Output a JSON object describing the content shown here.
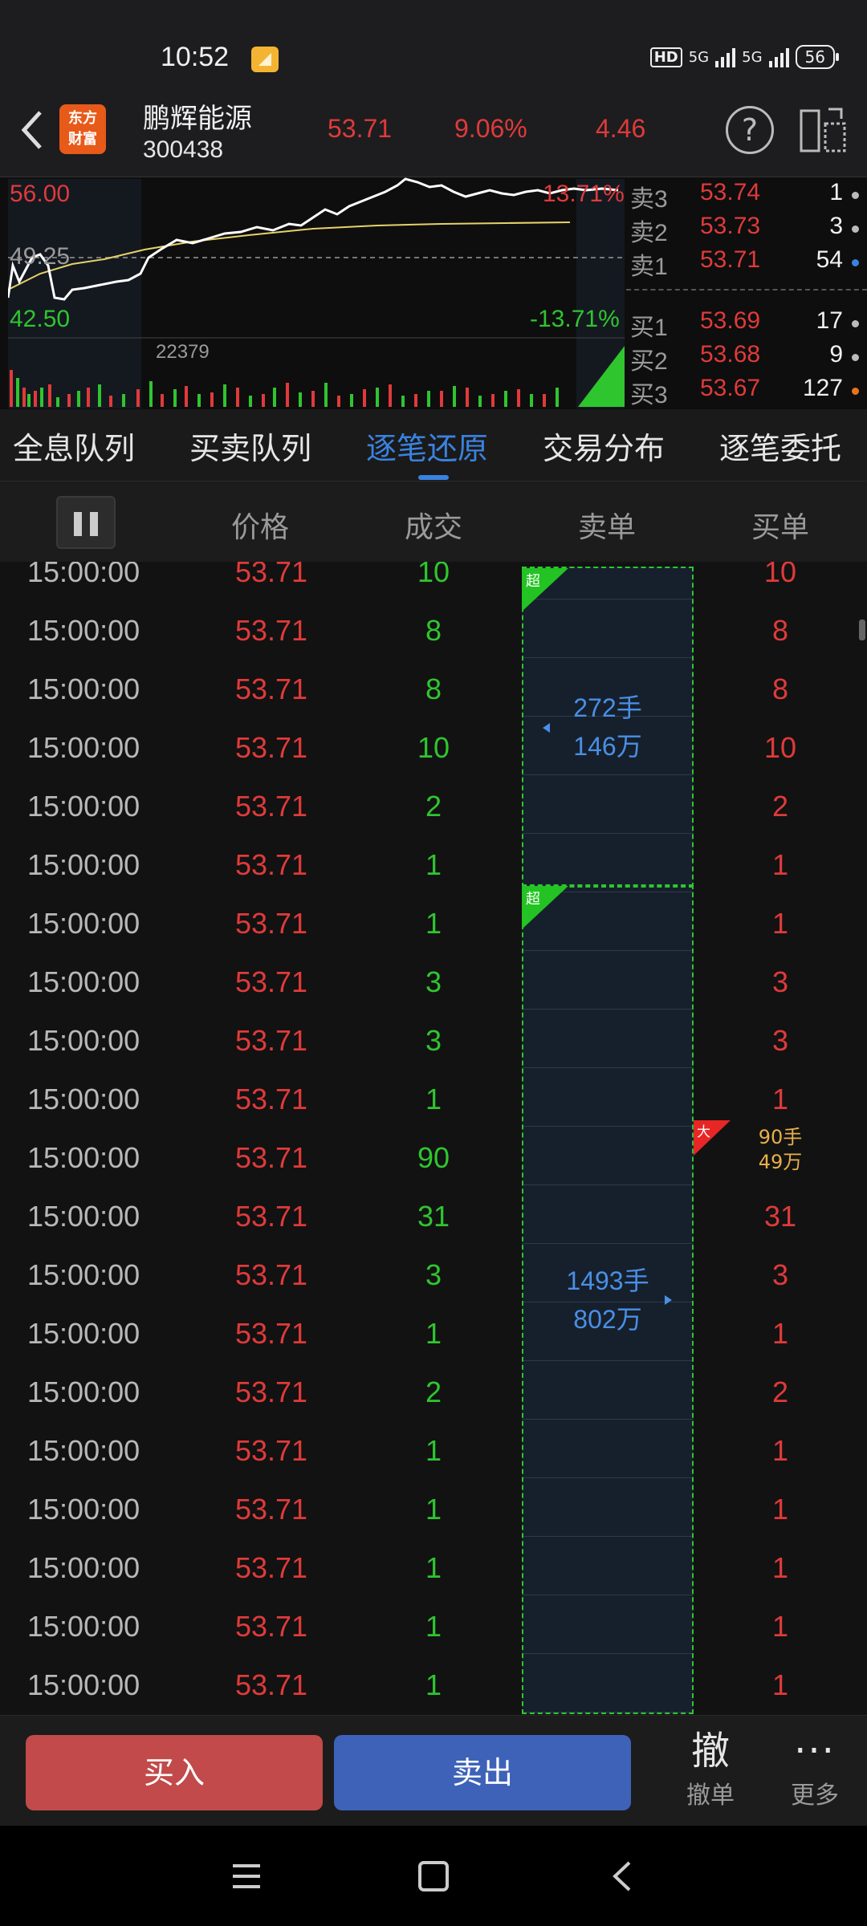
{
  "status_bar": {
    "time": "10:52",
    "network": "5G",
    "network2": "5G",
    "hd": "HD",
    "battery": "56"
  },
  "header": {
    "logo_text_1": "东方",
    "logo_text_2": "财富",
    "stock_name": "鹏辉能源",
    "stock_code": "300438",
    "price": "53.71",
    "change_pct": "9.06%",
    "change": "4.46"
  },
  "mini_chart": {
    "high": "56.00",
    "prev_close": "49.25",
    "low": "42.50",
    "high_pct": "13.71%",
    "low_pct": "-13.71%",
    "volume_max": "22379"
  },
  "order_book": {
    "asks": [
      {
        "label": "卖3",
        "price": "53.74",
        "volume": "1",
        "dot": "#bbbbbb"
      },
      {
        "label": "卖2",
        "price": "53.73",
        "volume": "3",
        "dot": "#bbbbbb"
      },
      {
        "label": "卖1",
        "price": "53.71",
        "volume": "54",
        "dot": "#3a82e0"
      }
    ],
    "bids": [
      {
        "label": "买1",
        "price": "53.69",
        "volume": "17",
        "dot": "#bbbbbb"
      },
      {
        "label": "买2",
        "price": "53.68",
        "volume": "9",
        "dot": "#bbbbbb"
      },
      {
        "label": "买3",
        "price": "53.67",
        "volume": "127",
        "dot": "#e8731f"
      }
    ]
  },
  "tabs": [
    "全息队列",
    "买卖队列",
    "逐笔还原",
    "交易分布",
    "逐笔委托"
  ],
  "active_tab": 2,
  "columns": {
    "price": "价格",
    "volume": "成交",
    "sell": "卖单",
    "buy": "买单"
  },
  "trades": [
    {
      "time": "15:00:00",
      "price": "53.71",
      "volume": "10",
      "buy": "10"
    },
    {
      "time": "15:00:00",
      "price": "53.71",
      "volume": "8",
      "buy": "8"
    },
    {
      "time": "15:00:00",
      "price": "53.71",
      "volume": "8",
      "buy": "8"
    },
    {
      "time": "15:00:00",
      "price": "53.71",
      "volume": "10",
      "buy": "10"
    },
    {
      "time": "15:00:00",
      "price": "53.71",
      "volume": "2",
      "buy": "2"
    },
    {
      "time": "15:00:00",
      "price": "53.71",
      "volume": "1",
      "buy": "1"
    },
    {
      "time": "15:00:00",
      "price": "53.71",
      "volume": "1",
      "buy": "1"
    },
    {
      "time": "15:00:00",
      "price": "53.71",
      "volume": "3",
      "buy": "3"
    },
    {
      "time": "15:00:00",
      "price": "53.71",
      "volume": "3",
      "buy": "3"
    },
    {
      "time": "15:00:00",
      "price": "53.71",
      "volume": "1",
      "buy": "1"
    },
    {
      "time": "15:00:00",
      "price": "53.71",
      "volume": "90",
      "buy": ""
    },
    {
      "time": "15:00:00",
      "price": "53.71",
      "volume": "31",
      "buy": "31"
    },
    {
      "time": "15:00:00",
      "price": "53.71",
      "volume": "3",
      "buy": "3"
    },
    {
      "time": "15:00:00",
      "price": "53.71",
      "volume": "1",
      "buy": "1"
    },
    {
      "time": "15:00:00",
      "price": "53.71",
      "volume": "2",
      "buy": "2"
    },
    {
      "time": "15:00:00",
      "price": "53.71",
      "volume": "1",
      "buy": "1"
    },
    {
      "time": "15:00:00",
      "price": "53.71",
      "volume": "1",
      "buy": "1"
    },
    {
      "time": "15:00:00",
      "price": "53.71",
      "volume": "1",
      "buy": "1"
    },
    {
      "time": "15:00:00",
      "price": "53.71",
      "volume": "1",
      "buy": "1"
    },
    {
      "time": "15:00:00",
      "price": "53.71",
      "volume": "1",
      "buy": "1"
    }
  ],
  "sell_orders": [
    {
      "tag": "超",
      "lots": "272手",
      "amount": "146万"
    },
    {
      "tag": "超",
      "lots": "1493手",
      "amount": "802万"
    }
  ],
  "big_buy": {
    "tag": "大",
    "lots": "90手",
    "amount": "49万"
  },
  "actions": {
    "buy": "买入",
    "sell": "卖出",
    "cancel_icon": "撤",
    "cancel": "撤单",
    "more_icon": "···",
    "more": "更多"
  },
  "colors": {
    "up": "#e03a3a",
    "down": "#2fc52f",
    "accent": "#3a82e0",
    "buy_btn": "#c24a4a",
    "sell_btn": "#3d62b8"
  }
}
